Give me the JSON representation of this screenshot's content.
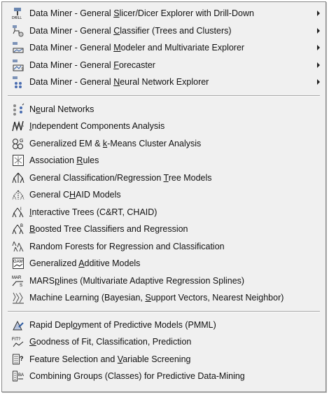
{
  "menu": {
    "submenus": [
      {
        "pre": "Data Miner - General ",
        "ul": "S",
        "post": "licer/Dicer Explorer with Drill-Down",
        "icon": "drill-icon",
        "has_arrow": true
      },
      {
        "pre": "Data Miner - General ",
        "ul": "C",
        "post": "lassifier (Trees and Clusters)",
        "icon": "classifier-icon",
        "has_arrow": true
      },
      {
        "pre": "Data Miner - General ",
        "ul": "M",
        "post": "odeler and Multivariate Explorer",
        "icon": "modeler-icon",
        "has_arrow": true
      },
      {
        "pre": "Data Miner - General ",
        "ul": "F",
        "post": "orecaster",
        "icon": "forecaster-icon",
        "has_arrow": true
      },
      {
        "pre": "Data Miner - General ",
        "ul": "N",
        "post": "eural Network Explorer",
        "icon": "neural-explorer-icon",
        "has_arrow": true
      }
    ],
    "tools": [
      {
        "pre": "N",
        "ul": "e",
        "post": "ural Networks",
        "icon": "neural-networks-icon"
      },
      {
        "pre": "",
        "ul": "I",
        "post": "ndependent Components Analysis",
        "icon": "ica-icon"
      },
      {
        "pre": "Generalized EM & ",
        "ul": "k",
        "post": "-Means Cluster Analysis",
        "icon": "em-kmeans-icon"
      },
      {
        "pre": "Association ",
        "ul": "R",
        "post": "ules",
        "icon": "association-rules-icon"
      },
      {
        "pre": "General Classification/Regression ",
        "ul": "T",
        "post": "ree Models",
        "icon": "tree-models-icon"
      },
      {
        "pre": "General C",
        "ul": "H",
        "post": "AID Models",
        "icon": "chaid-icon"
      },
      {
        "pre": "",
        "ul": "I",
        "post": "nteractive Trees (C&RT, CHAID)",
        "icon": "interactive-trees-icon"
      },
      {
        "pre": "",
        "ul": "B",
        "post": "oosted Tree Classifiers and Regression",
        "icon": "boosted-trees-icon"
      },
      {
        "pre": "Random Forests for Regression and Classification",
        "ul": "",
        "post": "",
        "icon": "random-forests-icon"
      },
      {
        "pre": "Generalized ",
        "ul": "A",
        "post": "dditive Models",
        "icon": "gam-icon"
      },
      {
        "pre": "MARS",
        "ul": "p",
        "post": "lines (Multivariate Adaptive Regression Splines)",
        "icon": "mars-icon"
      },
      {
        "pre": "Machine Learning (Bayesian, ",
        "ul": "S",
        "post": "upport Vectors, Nearest Neighbor)",
        "icon": "machine-learning-icon"
      }
    ],
    "deploy": [
      {
        "pre": "Rapid Depl",
        "ul": "o",
        "post": "yment of Predictive Models (PMML)",
        "icon": "pmml-icon"
      },
      {
        "pre": "",
        "ul": "G",
        "post": "oodness of Fit, Classification, Prediction",
        "icon": "goodness-fit-icon"
      },
      {
        "pre": "Feature Selection and ",
        "ul": "V",
        "post": "ariable Screening",
        "icon": "feature-selection-icon"
      },
      {
        "pre": "Combining Groups (Classes) for Predictive Data-Mining",
        "ul": "",
        "post": "",
        "icon": "combining-groups-icon"
      }
    ]
  }
}
